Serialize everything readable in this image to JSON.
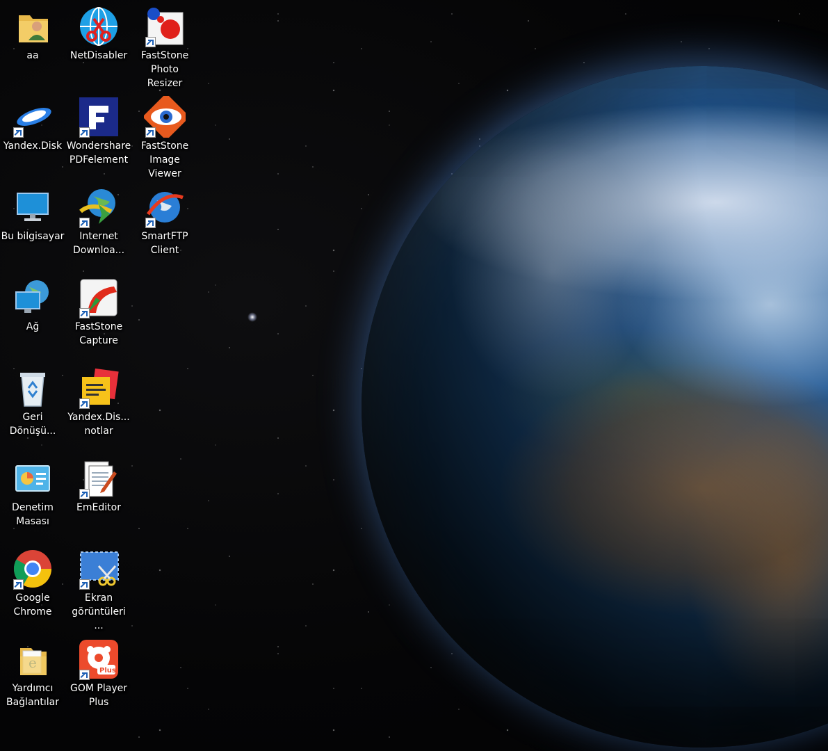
{
  "desktop": {
    "icons": [
      {
        "label": "aa",
        "icon": "user-folder-icon",
        "shortcut": false
      },
      {
        "label": "NetDisabler",
        "icon": "netdisabler-icon",
        "shortcut": false
      },
      {
        "label": "FastStone Photo Resizer",
        "icon": "faststone-photo-resizer-icon",
        "shortcut": true
      },
      {
        "label": "Yandex.Disk",
        "icon": "yandex-disk-icon",
        "shortcut": true
      },
      {
        "label": "Wondershare PDFelement",
        "icon": "pdfelement-icon",
        "shortcut": true
      },
      {
        "label": "FastStone Image Viewer",
        "icon": "faststone-image-viewer-icon",
        "shortcut": true
      },
      {
        "label": "Bu bilgisayar",
        "icon": "computer-icon",
        "shortcut": false
      },
      {
        "label": "Internet Downloa...",
        "icon": "internet-download-manager-icon",
        "shortcut": true
      },
      {
        "label": "SmartFTP Client",
        "icon": "smartftp-icon",
        "shortcut": true
      },
      {
        "label": "Ağ",
        "icon": "network-icon",
        "shortcut": false
      },
      {
        "label": "FastStone Capture",
        "icon": "faststone-capture-icon",
        "shortcut": true
      },
      {
        "label": "Geri Dönüşü...",
        "icon": "recycle-bin-icon",
        "shortcut": false
      },
      {
        "label": "Yandex.Dis... notlar",
        "icon": "yandex-notes-icon",
        "shortcut": true
      },
      {
        "label": "Denetim Masası",
        "icon": "control-panel-icon",
        "shortcut": false
      },
      {
        "label": "EmEditor",
        "icon": "emeditor-icon",
        "shortcut": true
      },
      {
        "label": "Google Chrome",
        "icon": "chrome-icon",
        "shortcut": true
      },
      {
        "label": "Ekran görüntüleri ...",
        "icon": "screenshots-folder-icon",
        "shortcut": true
      },
      {
        "label": "Yardımcı Bağlantılar",
        "icon": "helper-links-folder-icon",
        "shortcut": false
      },
      {
        "label": "GOM Player Plus",
        "icon": "gom-player-icon",
        "shortcut": true
      }
    ]
  },
  "colors": {
    "background": "#050506",
    "label_text": "#ffffff",
    "shortcut_arrow": "#1b5fb5"
  }
}
